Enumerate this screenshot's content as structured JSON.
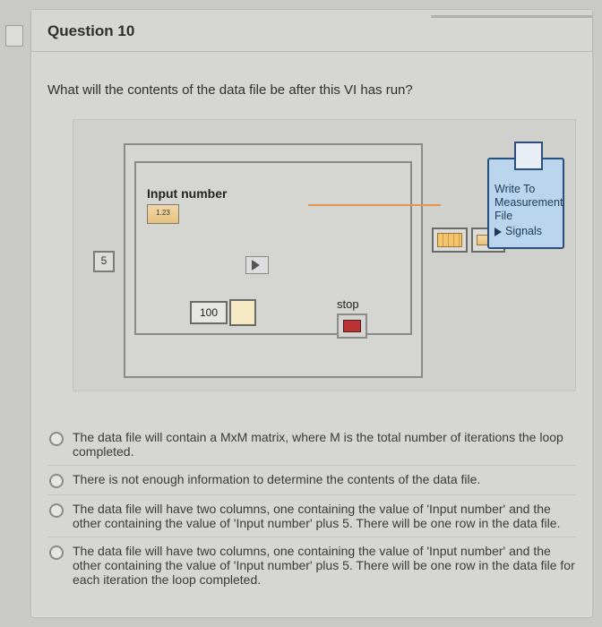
{
  "question": {
    "title": "Question 10",
    "prompt": "What will the contents of the data file be after this VI has run?"
  },
  "diagram": {
    "input_label": "Input number",
    "iteration_count_display": "5",
    "input_value_display": "100",
    "icon123_label": "1.23",
    "stop_label": "stop",
    "express_vi_name": "Write To Measurement File",
    "signals_label": "Signals"
  },
  "answers": [
    {
      "text": "The data file will contain a MxM matrix, where M is the total number of iterations the loop completed."
    },
    {
      "text": "There is not enough information to determine the contents of the data file."
    },
    {
      "text": "The data file will have two columns, one containing the value of 'Input number' and the other containing the value of 'Input number' plus 5. There will be one row in the data file."
    },
    {
      "text": "The data file will have two columns, one containing the value of 'Input number' and the other containing the value of 'Input number' plus 5. There will be one row in the data file for each iteration the loop completed."
    }
  ]
}
